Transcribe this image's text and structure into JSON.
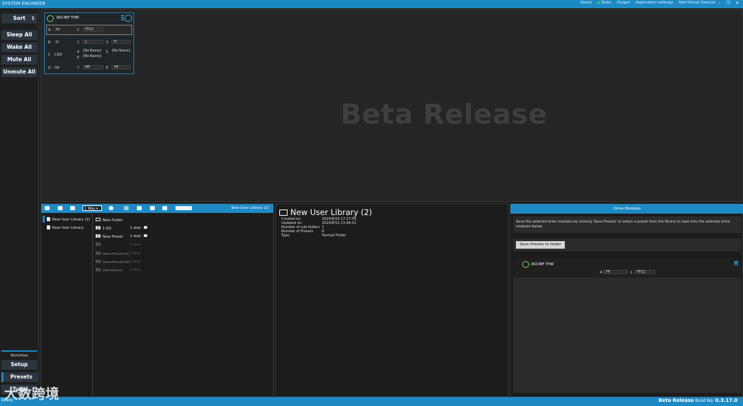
{
  "titlebar": {
    "app_name": "SYSTEM ENGINEER",
    "menu": [
      "About",
      "Tasks",
      "Output",
      "Application settings",
      "Add Virtual Devices"
    ],
    "window_controls": [
      "–",
      "❐",
      "✕"
    ]
  },
  "sidebar": {
    "sort_label": "Sort",
    "sort_icon": "↕",
    "buttons": [
      "Sleep All",
      "Wake All",
      "Mute All",
      "Unmute All"
    ],
    "workflow_label": "Workflow",
    "workflow": [
      "Setup",
      "Presets",
      "Tune"
    ]
  },
  "canvas": {
    "watermark": "Beta Release"
  },
  "device": {
    "name": "ASC48F  THW",
    "rows": [
      {
        "letter": "A",
        "group": "FP",
        "slots": [
          {
            "num": "1",
            "value": "FP12"
          }
        ]
      },
      {
        "letter": "B",
        "group": "PI",
        "slots": [
          {
            "num": "2",
            "value": "L"
          },
          {
            "num": "3",
            "value": "H"
          }
        ]
      },
      {
        "letter": "C",
        "group": "CDD",
        "slots": [
          {
            "num": "4",
            "value": "[No Name]"
          },
          {
            "num": "5",
            "value": "[No Name]"
          },
          {
            "num": "6",
            "value": "[No Name]"
          }
        ]
      },
      {
        "letter": "D",
        "group": "OA",
        "slots": [
          {
            "num": "7",
            "value": "MF"
          },
          {
            "num": "8",
            "value": "HF"
          }
        ]
      }
    ]
  },
  "library": {
    "way_select": "1 Way",
    "title": "New User Library (2)",
    "tree": [
      "New User Library (2)",
      "New User Library"
    ],
    "items": [
      {
        "name": "New Folder",
        "way": "",
        "locked": false,
        "dim": false,
        "icon": "folder"
      },
      {
        "name": "1-EQ",
        "way": "1 way",
        "locked": true,
        "dim": false,
        "icon": "grid"
      },
      {
        "name": "New Preset",
        "way": "1 way",
        "locked": true,
        "dim": false,
        "icon": "grid"
      },
      {
        "name": "",
        "way": "2 way",
        "locked": false,
        "dim": true,
        "icon": "grid"
      },
      {
        "name": "New Preset (2)",
        "way": "3 way",
        "locked": false,
        "dim": true,
        "icon": "grid"
      },
      {
        "name": "New Preset (3)",
        "way": "8 way",
        "locked": false,
        "dim": true,
        "icon": "grid"
      },
      {
        "name": "[No Name]",
        "way": "2 way",
        "locked": false,
        "dim": true,
        "icon": "grid"
      }
    ]
  },
  "details": {
    "title": "New User Library (2)",
    "fields": [
      {
        "key": "Created on:",
        "value": "2024/8/14 17:27:59"
      },
      {
        "key": "Updated on:",
        "value": "2024/8/15 13:46:31"
      },
      {
        "key": "Number of sub folders",
        "value": "1"
      },
      {
        "key": "Number of Presets",
        "value": "6"
      },
      {
        "key": "Type",
        "value": "Normal Folder"
      }
    ]
  },
  "drive_modules": {
    "header": "Drive Modules",
    "description": "Save the selected drive modules by clicking 'Save Presets' or select a preset from the library to load onto the selected drive modules below.",
    "save_button": "Save Presets to folder",
    "card_name": "ASC48F  THW",
    "card_row": {
      "letter": "A",
      "group": "FP",
      "num": "1",
      "value": "FP12"
    }
  },
  "statusbar": {
    "ready": "Ready",
    "beta": "Beta Release",
    "build_label": "Build No:",
    "build": "0.3.17.0"
  },
  "watermark": "大数跨境",
  "colors": {
    "accent": "#1e8ac5",
    "background": "#1b1b1b",
    "device_ok": "#7bd85a"
  }
}
